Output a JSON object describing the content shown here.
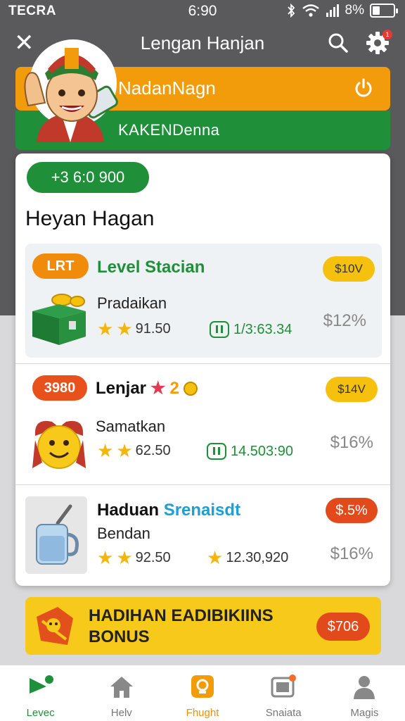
{
  "status_bar": {
    "carrier": "TECRA",
    "time": "6:90",
    "battery": "8%"
  },
  "header": {
    "title": "Lengan Hanjan"
  },
  "banner": {
    "top_text": "NadanNagn",
    "bottom_text": "KAKENDenna"
  },
  "card": {
    "pill_text": "+3 6:0 900",
    "heading": "Heyan Hagan",
    "items": [
      {
        "badge": "LRT",
        "title": "Level Stacian",
        "price": "$10V",
        "subtitle": "Pradaikan",
        "rating": "91.50",
        "meta": "1/3:63.34",
        "percent": "$12%"
      },
      {
        "badge": "3980",
        "title": "Lenjar",
        "title_suffix": "2",
        "price": "$14V",
        "subtitle": "Samatkan",
        "rating": "62.50",
        "meta": "14.503:90",
        "percent": "$16%"
      },
      {
        "title": "Haduan",
        "title_accent": "Srenaisdt",
        "price": "$.5%",
        "subtitle": "Bendan",
        "rating": "92.50",
        "meta": "12.30,920",
        "percent": "$16%"
      }
    ]
  },
  "bonus": {
    "line1": "HADIHAN EADIBIKIINS",
    "line2": "BONUS",
    "amount": "$706"
  },
  "bottom_nav": [
    {
      "label": "Levec"
    },
    {
      "label": "Helv"
    },
    {
      "label": "Fhught"
    },
    {
      "label": "Snaiata"
    },
    {
      "label": "Magis"
    }
  ],
  "colors": {
    "green": "#1f8f3a",
    "orange": "#f39c0b",
    "yellow": "#f6c10e",
    "red": "#e24a1c"
  }
}
